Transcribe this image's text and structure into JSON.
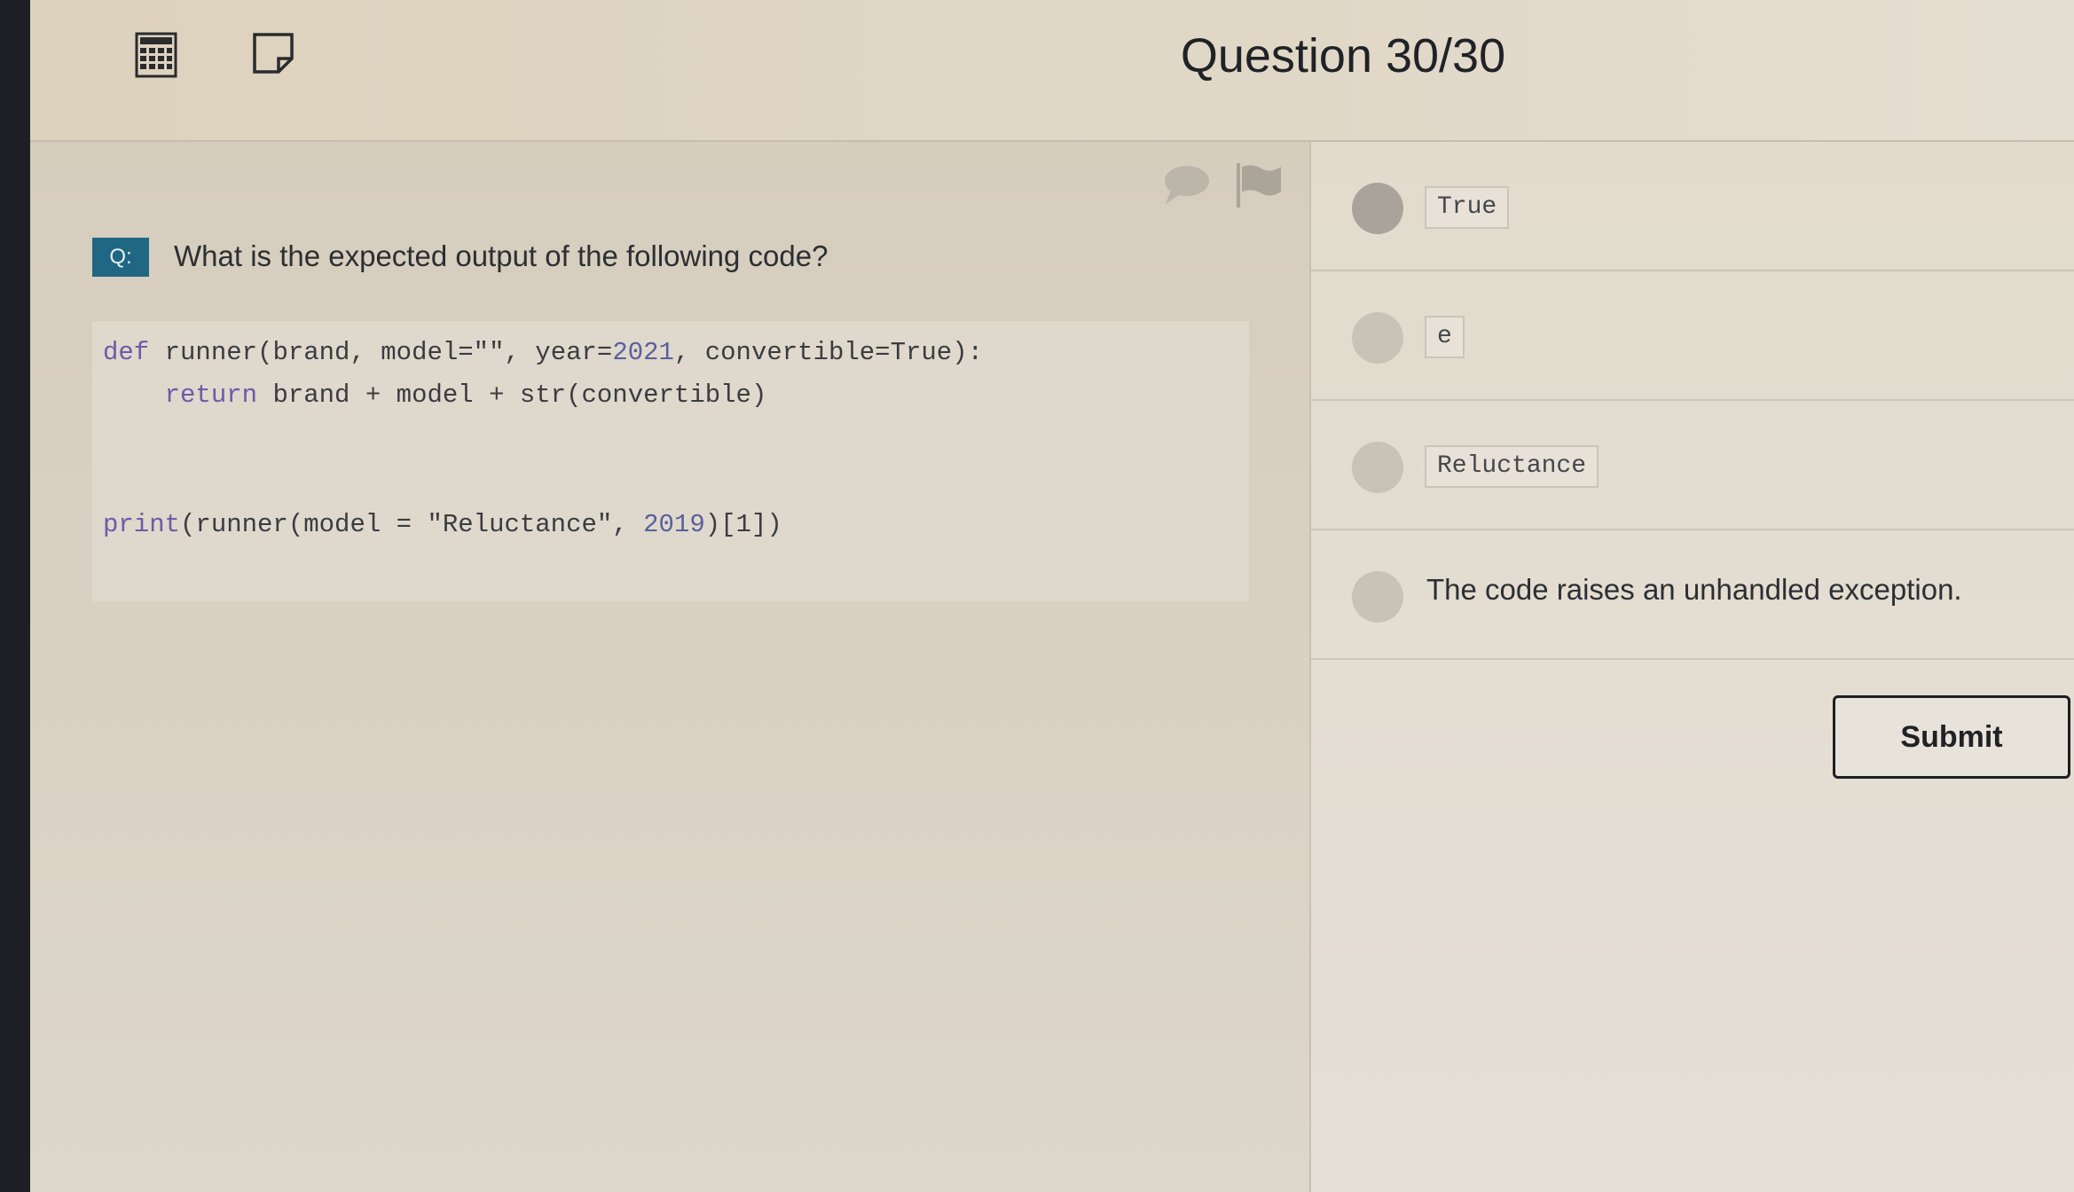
{
  "header": {
    "title": "Question 30/30",
    "tools": [
      {
        "icon": "calculator-icon"
      },
      {
        "icon": "note-icon"
      }
    ]
  },
  "question": {
    "badge": "Q:",
    "text": "What is the expected output of the following code?",
    "actions": [
      {
        "icon": "comment-icon"
      },
      {
        "icon": "flag-icon"
      }
    ],
    "code": {
      "line1": {
        "kw": "def",
        "rest": " runner(brand, model=\"\", year=",
        "num": "2021",
        "rest2": ", convertible=True):"
      },
      "line2": {
        "indent": "    ",
        "kw": "return",
        "rest": " brand + model + str(convertible)"
      },
      "line3": {
        "kw": "print",
        "rest": "(runner(model = \"Reluctance\", ",
        "num": "2019",
        "rest2": ")[1])"
      }
    }
  },
  "options": [
    {
      "label": "True",
      "style": "code",
      "selected": false
    },
    {
      "label": "e",
      "style": "code",
      "selected": false
    },
    {
      "label": "Reluctance",
      "style": "code",
      "selected": false
    },
    {
      "label": "The code raises an unhandled exception.",
      "style": "text",
      "selected": false
    }
  ],
  "submit_label": "Submit",
  "colors": {
    "badge": "#1f6783",
    "keyword": "#6f59a8",
    "background": "#ddd4c2"
  }
}
